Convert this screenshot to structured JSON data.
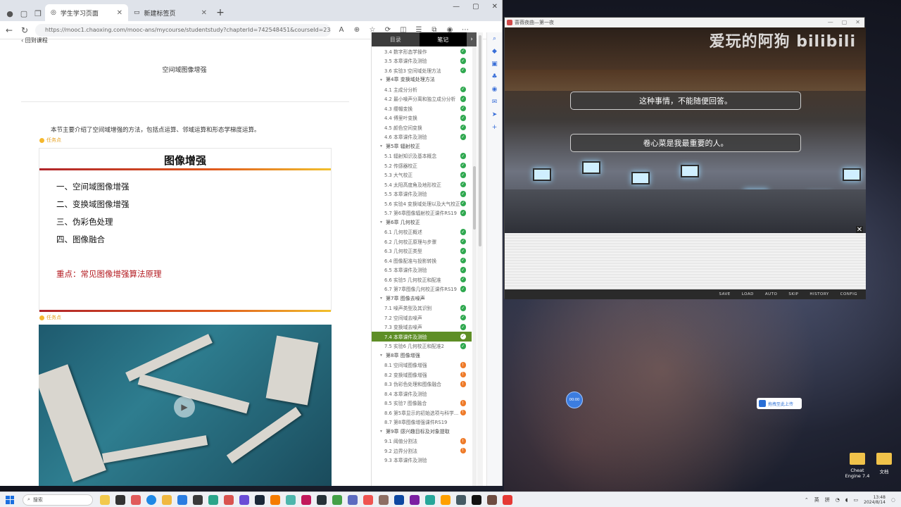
{
  "browser": {
    "tabs": [
      {
        "label": "学生学习页面",
        "active": true
      },
      {
        "label": "新建标签页",
        "active": false
      }
    ],
    "url": "https://mooc1.chaoxing.com/mooc-ans/mycourse/studentstudy?chapterId=742548451&courseId=234725196&clazzid=96172670&enc=2..."
  },
  "page": {
    "back_label": "回到课程",
    "title": "空间域图像增强",
    "intro": "本节主要介绍了空间域增强的方法，包括点运算、邻域运算和形态学梯度运算。",
    "task_label": "任务点"
  },
  "slide": {
    "heading": "图像增强",
    "items": [
      "一、空间域图像增强",
      "二、变换域图像增强",
      "三、伪彩色处理",
      "四、图像融合"
    ],
    "key_point": "重点：常见图像增强算法原理"
  },
  "toc": {
    "tab_catalog": "目录",
    "tab_notes": "笔记",
    "rows": [
      {
        "type": "sec",
        "label": "3.4 数字形态学操作",
        "status": "ok"
      },
      {
        "type": "sec",
        "label": "3.5 本章课件及测验",
        "status": "ok"
      },
      {
        "type": "sec",
        "label": "3.6 实验3 空间域处理方法",
        "status": "ok"
      },
      {
        "type": "chap",
        "label": "第4章 变换域处理方法",
        "status": ""
      },
      {
        "type": "sec",
        "label": "4.1 主成分分析",
        "status": "ok"
      },
      {
        "type": "sec",
        "label": "4.2 最小噪声分离和独立成分分析",
        "status": "ok"
      },
      {
        "type": "sec",
        "label": "4.3 缨帽变换",
        "status": "ok"
      },
      {
        "type": "sec",
        "label": "4.4 傅里叶变换",
        "status": "ok"
      },
      {
        "type": "sec",
        "label": "4.5 颜色空间变换",
        "status": "ok"
      },
      {
        "type": "sec",
        "label": "4.6 本章课件及测验",
        "status": "ok"
      },
      {
        "type": "chap",
        "label": "第5章 辐射校正",
        "status": ""
      },
      {
        "type": "sec",
        "label": "5.1 辐射知识及基本概念",
        "status": "ok"
      },
      {
        "type": "sec",
        "label": "5.2 传感器校正",
        "status": "ok"
      },
      {
        "type": "sec",
        "label": "5.3 大气校正",
        "status": "ok"
      },
      {
        "type": "sec",
        "label": "5.4 太阳高度角及地形校正",
        "status": "ok"
      },
      {
        "type": "sec",
        "label": "5.5 本章课件及测验",
        "status": "ok"
      },
      {
        "type": "sec",
        "label": "5.6 实验4 变换域处理以及大气校正",
        "status": "ok"
      },
      {
        "type": "sec",
        "label": "5.7 第6章图像辐射校正课件RS19",
        "status": "ok"
      },
      {
        "type": "chap",
        "label": "第6章 几何校正",
        "status": ""
      },
      {
        "type": "sec",
        "label": "6.1 几何校正概述",
        "status": "ok"
      },
      {
        "type": "sec",
        "label": "6.2 几何校正原理与步骤",
        "status": "ok"
      },
      {
        "type": "sec",
        "label": "6.3 几何校正类型",
        "status": "ok"
      },
      {
        "type": "sec",
        "label": "6.4 图像配准与投影转换",
        "status": "ok"
      },
      {
        "type": "sec",
        "label": "6.5 本章课件及测验",
        "status": "ok"
      },
      {
        "type": "sec",
        "label": "6.6 实验5 几何校正和配准",
        "status": "ok"
      },
      {
        "type": "sec",
        "label": "6.7 第7章图像几何校正课件RS19",
        "status": "ok"
      },
      {
        "type": "chap",
        "label": "第7章 图像去噪声",
        "status": ""
      },
      {
        "type": "sec",
        "label": "7.1 噪声类型及其识别",
        "status": "ok"
      },
      {
        "type": "sec",
        "label": "7.2 空间域去噪声",
        "status": "ok"
      },
      {
        "type": "sec",
        "label": "7.3 变换域去噪声",
        "status": "ok"
      },
      {
        "type": "sec",
        "label": "7.4 本章课件及测验",
        "status": "hl"
      },
      {
        "type": "sec",
        "label": "7.5 实验6 几何校正和配准2",
        "status": "ok"
      },
      {
        "type": "chap",
        "label": "第8章 图像增强",
        "status": ""
      },
      {
        "type": "sec",
        "label": "8.1 空间域图像增强",
        "status": "warn"
      },
      {
        "type": "sec",
        "label": "8.2 变换域图像增强",
        "status": "warn"
      },
      {
        "type": "sec",
        "label": "8.3 伪彩色处理和图像融合",
        "status": "warn"
      },
      {
        "type": "sec",
        "label": "8.4 本章课件及测验",
        "status": ""
      },
      {
        "type": "sec",
        "label": "8.5 实验7 图像融合",
        "status": "warn"
      },
      {
        "type": "sec",
        "label": "8.6 第5章显示的初始选项与科学...",
        "status": "warn"
      },
      {
        "type": "sec",
        "label": "8.7 第8章图像增强课件RS19",
        "status": ""
      },
      {
        "type": "chap",
        "label": "第9章 感兴趣目标及对象提取",
        "status": ""
      },
      {
        "type": "sec",
        "label": "9.1 阈值分割法",
        "status": "warn"
      },
      {
        "type": "sec",
        "label": "9.2 边界分割法",
        "status": "warn"
      },
      {
        "type": "sec",
        "label": "9.3 本章课件及测验",
        "status": ""
      }
    ]
  },
  "game": {
    "window_title": "蔷薇夜曲—第一夜",
    "watermark": "爱玩的阿狗 bilibili",
    "choices": [
      "这种事情，不能随便回答。",
      "卷心菜是我最重要的人。"
    ],
    "menu": [
      "SAVE",
      "LOAD",
      "AUTO",
      "SKIP",
      "HISTORY",
      "CONFIG"
    ]
  },
  "desktop": {
    "timer": "00:00",
    "upload_label": "拖拽至此上传",
    "icons": [
      {
        "label": "Cheat Engine 7.4"
      },
      {
        "label": "文档"
      }
    ]
  },
  "taskbar": {
    "search_placeholder": "搜索",
    "lang": "英",
    "ime": "拼",
    "time": "13:48",
    "date": "2024/8/14"
  },
  "colors": {
    "accent_green": "#5e8e26",
    "status_ok": "#2fa84f",
    "status_warn": "#ee7a28",
    "key_red": "#b3191f"
  }
}
